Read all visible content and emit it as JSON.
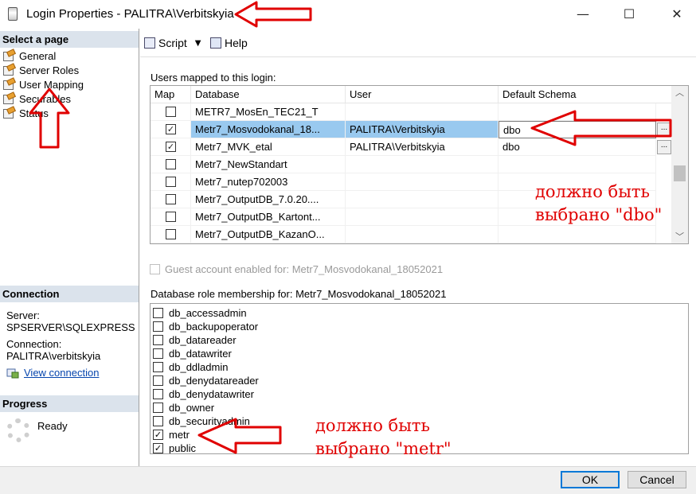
{
  "window": {
    "title": "Login Properties - PALITRA\\Verbitskyia",
    "controls": [
      "—",
      "☐",
      "✕"
    ]
  },
  "sidebar": {
    "select_page_header": "Select a page",
    "pages": [
      {
        "label": "General",
        "icon": "page-properties-icon"
      },
      {
        "label": "Server Roles",
        "icon": "page-properties-icon"
      },
      {
        "label": "User Mapping",
        "icon": "page-properties-icon"
      },
      {
        "label": "Securables",
        "icon": "page-properties-icon"
      },
      {
        "label": "Status",
        "icon": "page-properties-icon"
      }
    ],
    "connection_header": "Connection",
    "server_label": "Server:",
    "server_value": "SPSERVER\\SQLEXPRESS",
    "connection_label": "Connection:",
    "connection_value": "PALITRA\\verbitskyia",
    "view_connection_link": "View connection",
    "progress_header": "Progress",
    "progress_status": "Ready"
  },
  "toolbar": {
    "script_label": "Script",
    "help_label": "Help"
  },
  "users_mapped": {
    "label": "Users mapped to this login:",
    "columns": [
      "Map",
      "Database",
      "User",
      "Default Schema"
    ],
    "rows": [
      {
        "map": false,
        "database": "METR7_MosEn_TEC21_T",
        "user": "",
        "schema": ""
      },
      {
        "map": true,
        "database": "Metr7_Mosvodokanal_18...",
        "user": "PALITRA\\Verbitskyia",
        "schema": "dbo"
      },
      {
        "map": true,
        "database": "Metr7_MVK_etal",
        "user": "PALITRA\\Verbitskyia",
        "schema": "dbo"
      },
      {
        "map": false,
        "database": "Metr7_NewStandart",
        "user": "",
        "schema": ""
      },
      {
        "map": false,
        "database": "Metr7_nutep702003",
        "user": "",
        "schema": ""
      },
      {
        "map": false,
        "database": "Metr7_OutputDB_7.0.20....",
        "user": "",
        "schema": ""
      },
      {
        "map": false,
        "database": "Metr7_OutputDB_Kartont...",
        "user": "",
        "schema": ""
      },
      {
        "map": false,
        "database": "Metr7_OutputDB_KazanO...",
        "user": "",
        "schema": ""
      }
    ],
    "selected_row": 1,
    "ellipsis": "..."
  },
  "guest": {
    "label": "Guest account enabled for: Metr7_Mosvodokanal_18052021",
    "checked": false
  },
  "roles": {
    "label": "Database role membership for: Metr7_Mosvodokanal_18052021",
    "items": [
      {
        "name": "db_accessadmin",
        "checked": false
      },
      {
        "name": "db_backupoperator",
        "checked": false
      },
      {
        "name": "db_datareader",
        "checked": false
      },
      {
        "name": "db_datawriter",
        "checked": false
      },
      {
        "name": "db_ddladmin",
        "checked": false
      },
      {
        "name": "db_denydatareader",
        "checked": false
      },
      {
        "name": "db_denydatawriter",
        "checked": false
      },
      {
        "name": "db_owner",
        "checked": false
      },
      {
        "name": "db_securityadmin",
        "checked": false
      },
      {
        "name": "metr",
        "checked": true
      },
      {
        "name": "public",
        "checked": true
      }
    ]
  },
  "buttons": {
    "ok": "OK",
    "cancel": "Cancel"
  },
  "annotations": {
    "note_dbo_line1": "должно быть",
    "note_dbo_line2": "выбрано \"dbo\"",
    "note_metr_line1": "должно быть",
    "note_metr_line2": "выбрано \"metr\"",
    "color": "#e00000"
  },
  "colors": {
    "selected_row": "#99c9ef",
    "section_header": "#dbe3ec",
    "link": "#0645ad",
    "ok_border": "#0078d7"
  }
}
